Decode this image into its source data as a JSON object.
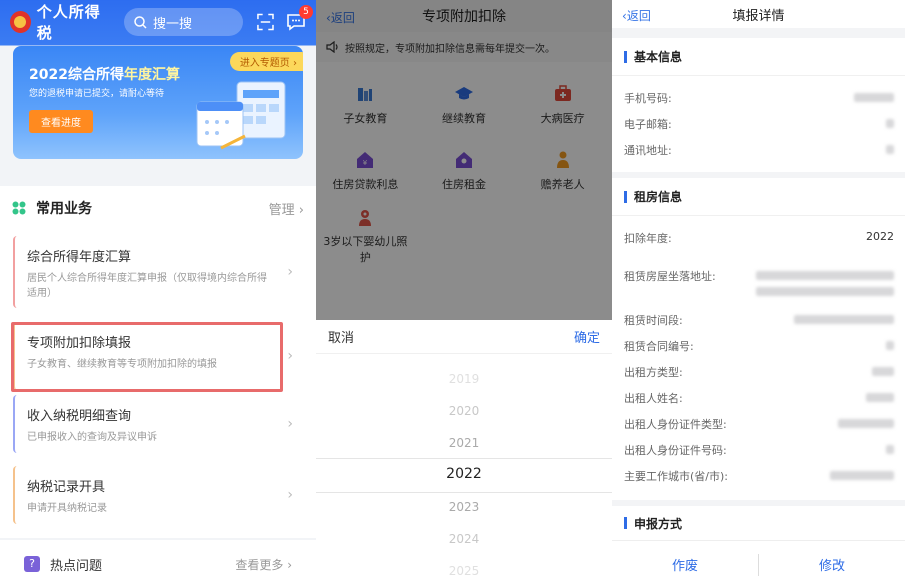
{
  "app": {
    "title": "个人所得税",
    "search_placeholder": "搜一搜",
    "message_badge": "5",
    "banner": {
      "tag": "进入专题页",
      "title_prefix": "2022综合所得",
      "title_highlight": "年度汇算",
      "subtitle": "您的退税申请已提交，请耐心等待",
      "button": "查看进度"
    },
    "common": {
      "title": "常用业务",
      "manage": "管理",
      "items": [
        {
          "title": "综合所得年度汇算",
          "desc": "居民个人综合所得年度汇算申报（仅取得境内综合所得适用）"
        },
        {
          "title": "专项附加扣除填报",
          "desc": "子女教育、继续教育等专项附加扣除的填报"
        },
        {
          "title": "收入纳税明细查询",
          "desc": "已申报收入的查询及异议申诉"
        },
        {
          "title": "纳税记录开具",
          "desc": "申请开具纳税记录"
        }
      ]
    },
    "hot": {
      "title": "热点问题",
      "more": "查看更多"
    }
  },
  "deduction": {
    "back": "返回",
    "title": "专项附加扣除",
    "notice": "按照规定，专项附加扣除信息需每年提交一次。",
    "grid": [
      {
        "label": "子女教育",
        "icon": "children-education-icon"
      },
      {
        "label": "继续教育",
        "icon": "graduation-cap-icon"
      },
      {
        "label": "大病医疗",
        "icon": "medical-kit-icon"
      },
      {
        "label": "住房贷款利息",
        "icon": "house-loan-icon"
      },
      {
        "label": "住房租金",
        "icon": "house-rent-icon"
      },
      {
        "label": "赡养老人",
        "icon": "elderly-care-icon"
      },
      {
        "label": "3岁以下婴幼儿照护",
        "icon": "infant-care-icon"
      }
    ],
    "picker": {
      "cancel": "取消",
      "confirm": "确定",
      "years": [
        "2019",
        "2020",
        "2021",
        "2022",
        "2023",
        "2024",
        "2025"
      ],
      "selected": "2022"
    }
  },
  "detail": {
    "back": "返回",
    "title": "填报详情",
    "basic": {
      "title": "基本信息",
      "fields": [
        "手机号码:",
        "电子邮箱:",
        "通讯地址:"
      ]
    },
    "rent": {
      "title": "租房信息",
      "year_label": "扣除年度:",
      "year_value": "2022",
      "fields": [
        "租赁房屋坐落地址:",
        "租赁时间段:",
        "租赁合同编号:",
        "出租方类型:",
        "出租人姓名:",
        "出租人身份证件类型:",
        "出租人身份证件号码:",
        "主要工作城市(省/市):"
      ]
    },
    "declare": {
      "title": "申报方式"
    },
    "actions": {
      "void": "作废",
      "modify": "修改"
    }
  },
  "colors": {
    "primary": "#2e6ce6",
    "header_blue": "#3b7cf3",
    "highlight_red": "#e86b6b",
    "banner_orange": "#ff8a1f"
  }
}
